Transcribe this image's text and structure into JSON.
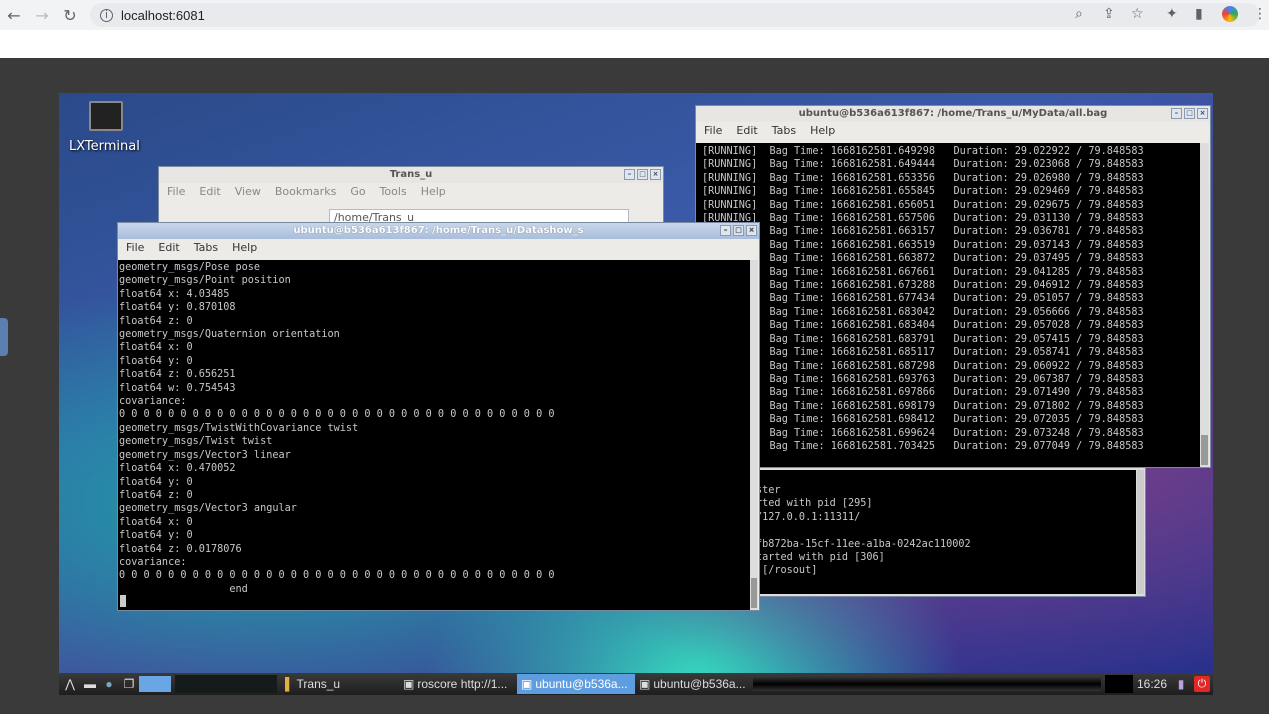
{
  "browser": {
    "url": "localhost:6081"
  },
  "desktop": {
    "icon_label": "LXTerminal"
  },
  "file_manager": {
    "title": "Trans_u",
    "menu": [
      "File",
      "Edit",
      "View",
      "Bookmarks",
      "Go",
      "Tools",
      "Help"
    ],
    "path": "/home/Trans_u"
  },
  "terminal_datashow": {
    "title": "ubuntu@b536a613f867: /home/Trans_u/Datashow_s",
    "menu": [
      "File",
      "Edit",
      "Tabs",
      "Help"
    ],
    "lines": [
      "geometry_msgs/Pose pose",
      "geometry_msgs/Point position",
      "float64 x: 4.03485",
      "float64 y: 0.870108",
      "float64 z: 0",
      "geometry_msgs/Quaternion orientation",
      "float64 x: 0",
      "float64 y: 0",
      "float64 z: 0.656251",
      "float64 w: 0.754543",
      "covariance:",
      "0 0 0 0 0 0 0 0 0 0 0 0 0 0 0 0 0 0 0 0 0 0 0 0 0 0 0 0 0 0 0 0 0 0 0 0",
      "geometry_msgs/TwistWithCovariance twist",
      "geometry_msgs/Twist twist",
      "geometry_msgs/Vector3 linear",
      "float64 x: 0.470052",
      "float64 y: 0",
      "float64 z: 0",
      "geometry_msgs/Vector3 angular",
      "float64 x: 0",
      "float64 y: 0",
      "float64 z: 0.0178076",
      "covariance:",
      "0 0 0 0 0 0 0 0 0 0 0 0 0 0 0 0 0 0 0 0 0 0 0 0 0 0 0 0 0 0 0 0 0 0 0 0",
      "                  end"
    ]
  },
  "terminal_bag": {
    "title": "ubuntu@b536a613f867: /home/Trans_u/MyData/all.bag",
    "menu": [
      "File",
      "Edit",
      "Tabs",
      "Help"
    ],
    "lines": [
      "[RUNNING]  Bag Time: 1668162581.649298   Duration: 29.022922 / 79.848583",
      "[RUNNING]  Bag Time: 1668162581.649444   Duration: 29.023068 / 79.848583",
      "[RUNNING]  Bag Time: 1668162581.653356   Duration: 29.026980 / 79.848583",
      "[RUNNING]  Bag Time: 1668162581.655845   Duration: 29.029469 / 79.848583",
      "[RUNNING]  Bag Time: 1668162581.656051   Duration: 29.029675 / 79.848583",
      "[RUNNING]  Bag Time: 1668162581.657506   Duration: 29.031130 / 79.848583",
      "[RUNNING]  Bag Time: 1668162581.663157   Duration: 29.036781 / 79.848583",
      "[RUNNING]  Bag Time: 1668162581.663519   Duration: 29.037143 / 79.848583",
      "[RUNNING]  Bag Time: 1668162581.663872   Duration: 29.037495 / 79.848583",
      "[RUNNING]  Bag Time: 1668162581.667661   Duration: 29.041285 / 79.848583",
      "[RUNNING]  Bag Time: 1668162581.673288   Duration: 29.046912 / 79.848583",
      "[RUNNING]  Bag Time: 1668162581.677434   Duration: 29.051057 / 79.848583",
      "[RUNNING]  Bag Time: 1668162581.683042   Duration: 29.056666 / 79.848583",
      "[RUNNING]  Bag Time: 1668162581.683404   Duration: 29.057028 / 79.848583",
      "[RUNNING]  Bag Time: 1668162581.683791   Duration: 29.057415 / 79.848583",
      "[RUNNING]  Bag Time: 1668162581.685117   Duration: 29.058741 / 79.848583",
      "[RUNNING]  Bag Time: 1668162581.687298   Duration: 29.060922 / 79.848583",
      "[RUNNING]  Bag Time: 1668162581.693763   Duration: 29.067387 / 79.848583",
      "[RUNNING]  Bag Time: 1668162581.697866   Duration: 29.071490 / 79.848583",
      "[RUNNING]  Bag Time: 1668162581.698179   Duration: 29.071802 / 79.848583",
      "[RUNNING]  Bag Time: 1668162581.698412   Duration: 29.072035 / 79.848583",
      "[RUNNING]  Bag Time: 1668162581.699624   Duration: 29.073248 / 79.848583",
      "[RUNNING]  Bag Time: 1668162581.703425   Duration: 29.077049 / 79.848583"
    ]
  },
  "terminal_roscore": {
    "lines": [
      "ster",
      "rted with pid [295]",
      "/127.0.0.1:11311/",
      "",
      "fb872ba-15cf-11ee-a1ba-0242ac110002",
      "tarted with pid [306]",
      " [/rosout]"
    ]
  },
  "taskbar": {
    "tasks": [
      "Trans_u",
      "roscore http://1...",
      "ubuntu@b536a...",
      "ubuntu@b536a..."
    ],
    "clock": "16:26"
  }
}
